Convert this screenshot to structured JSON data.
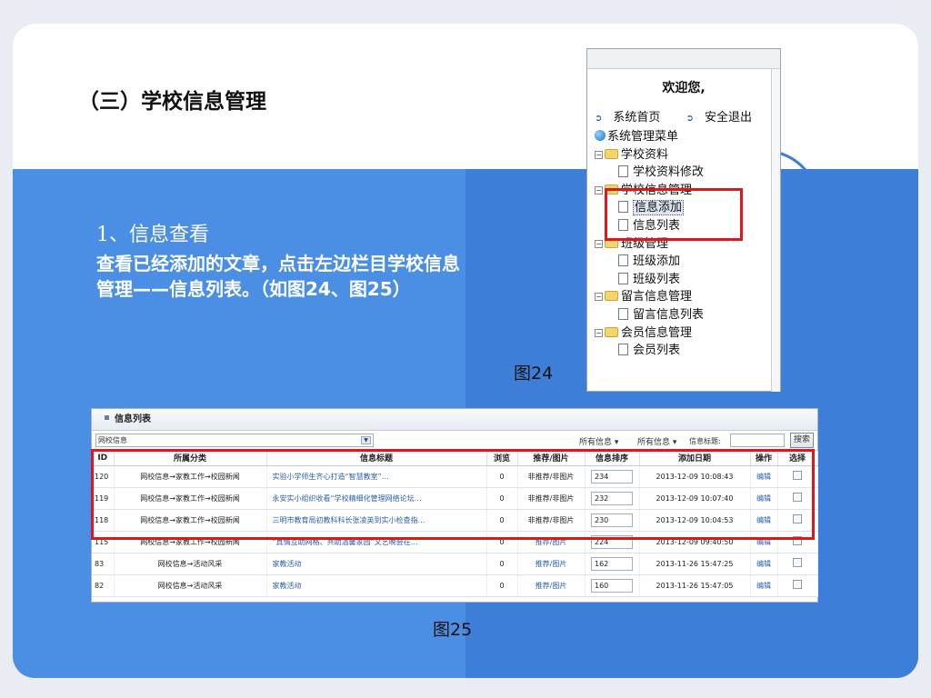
{
  "slide": {
    "title": "（三）学校信息管理",
    "step_number": "1、信息查看",
    "step_desc": "查看已经添加的文章，点击左边栏目学校信息管理——信息列表。（如图24、图25）",
    "caption24": "图24",
    "caption25": "图25",
    "colors": {
      "top": "#ffffff",
      "left_panel": "#4a8fe4",
      "right_panel": "#3d7fd8",
      "highlight": "#e0161b"
    }
  },
  "fig24": {
    "welcome": "欢迎您,",
    "links": [
      "系统首页",
      "安全退出"
    ],
    "menu_root": "系统管理菜单",
    "tree": [
      {
        "label": "学校资料",
        "kind": "folder"
      },
      {
        "label": "学校资料修改",
        "kind": "leaf"
      },
      {
        "label": "学校信息管理",
        "kind": "folder"
      },
      {
        "label": "信息添加",
        "kind": "leaf",
        "selected": true
      },
      {
        "label": "信息列表",
        "kind": "leaf"
      },
      {
        "label": "班级管理",
        "kind": "folder"
      },
      {
        "label": "班级添加",
        "kind": "leaf"
      },
      {
        "label": "班级列表",
        "kind": "leaf"
      },
      {
        "label": "留言信息管理",
        "kind": "folder"
      },
      {
        "label": "留言信息列表",
        "kind": "leaf"
      },
      {
        "label": "会员信息管理",
        "kind": "folder"
      },
      {
        "label": "会员列表",
        "kind": "leaf"
      }
    ]
  },
  "fig25": {
    "title": "信息列表",
    "category_select": "网校信息",
    "filter1": "所有信息",
    "filter2": "所有信息",
    "search_label": "信息标题:",
    "search_button": "搜索",
    "columns": [
      "ID",
      "所属分类",
      "信息标题",
      "浏览",
      "推荐/图片",
      "信息排序",
      "添加日期",
      "操作",
      "选择"
    ],
    "rows": [
      {
        "id": "120",
        "cat": "网校信息→家教工作→校园新闻",
        "title": "实验小学师生齐心打造“智慧教室”…",
        "views": "0",
        "rec": "非推荐/非图片",
        "order": "234",
        "date": "2013-12-09 10:08:43",
        "op": "编辑"
      },
      {
        "id": "119",
        "cat": "网校信息→家教工作→校园新闻",
        "title": "永安实小组织收看“学校精细化管理网络论坛…",
        "views": "0",
        "rec": "非推荐/非图片",
        "order": "232",
        "date": "2013-12-09 10:07:40",
        "op": "编辑"
      },
      {
        "id": "118",
        "cat": "网校信息→家教工作→校园新闻",
        "title": "三明市教育局初教科科长张凌英到实小检查指…",
        "views": "0",
        "rec": "非推荐/非图片",
        "order": "230",
        "date": "2013-12-09 10:04:53",
        "op": "编辑"
      },
      {
        "id": "115",
        "cat": "网校信息→家教工作→校园新闻",
        "title": "“真情互助网格、共助温馨家园”文艺晚会在…",
        "views": "0",
        "rec": "推荐/图片",
        "order": "224",
        "date": "2013-12-09 09:40:50",
        "op": "编辑"
      },
      {
        "id": "83",
        "cat": "网校信息→活动风采",
        "title": "家教活动",
        "views": "0",
        "rec": "推荐/图片",
        "order": "162",
        "date": "2013-11-26 15:47:25",
        "op": "编辑"
      },
      {
        "id": "82",
        "cat": "网校信息→活动风采",
        "title": "家教活动",
        "views": "0",
        "rec": "推荐/图片",
        "order": "160",
        "date": "2013-11-26 15:47:05",
        "op": "编辑"
      }
    ]
  }
}
